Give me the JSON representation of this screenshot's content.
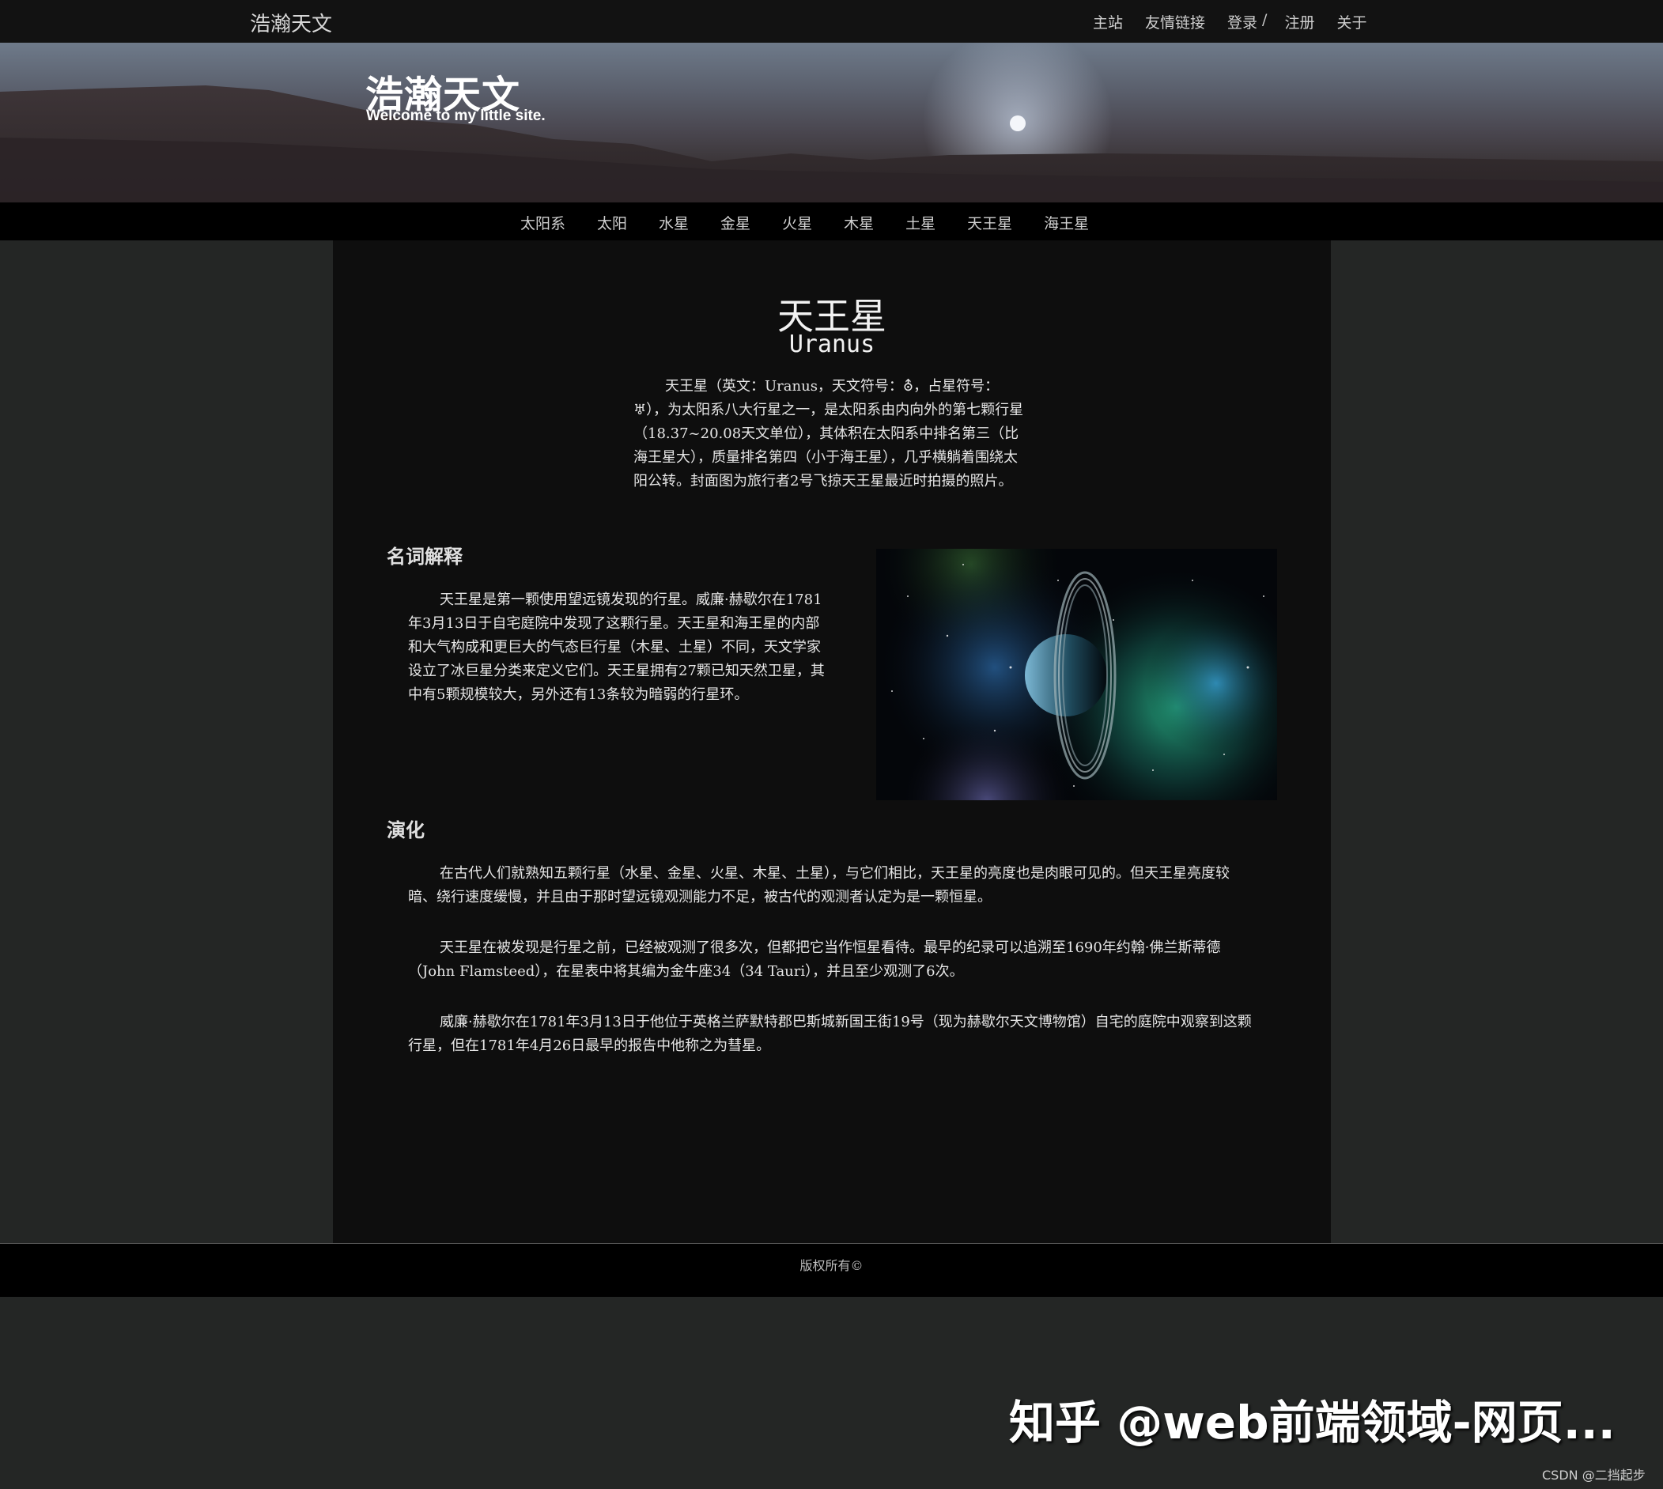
{
  "topbar": {
    "site_name": "浩瀚天文",
    "links": {
      "main": "主站",
      "friends": "友情链接",
      "login": "登录",
      "sep": "/",
      "register": "注册",
      "about": "关于"
    }
  },
  "banner": {
    "title": "浩瀚天文",
    "subtitle": "Welcome to my little site."
  },
  "nav": {
    "items": [
      "太阳系",
      "太阳",
      "水星",
      "金星",
      "火星",
      "木星",
      "土星",
      "天王星",
      "海王星"
    ]
  },
  "article": {
    "title_cn": "天王星",
    "title_en": "Uranus",
    "intro": "天王星（英文：Uranus，天文符号：⛢，占星符号：♅），为太阳系八大行星之一，是太阳系由内向外的第七颗行星（18.37~20.08天文单位），其体积在太阳系中排名第三（比海王星大），质量排名第四（小于海王星），几乎横躺着围绕太阳公转。封面图为旅行者2号飞掠天王星最近时拍摄的照片。",
    "terms_heading": "名词解释",
    "terms_text": "天王星是第一颗使用望远镜发现的行星。威廉·赫歇尔在1781年3月13日于自宅庭院中发现了这颗行星。天王星和海王星的内部和大气构成和更巨大的气态巨行星（木星、土星）不同，天文学家设立了冰巨星分类来定义它们。天王星拥有27颗已知天然卫星，其中有5颗规模较大，另外还有13条较为暗弱的行星环。",
    "evolution_heading": "演化",
    "evolution_paragraphs": [
      "在古代人们就熟知五颗行星（水星、金星、火星、木星、土星），与它们相比，天王星的亮度也是肉眼可见的。但天王星亮度较暗、绕行速度缓慢，并且由于那时望远镜观测能力不足，被古代的观测者认定为是一颗恒星。",
      "天王星在被发现是行星之前，已经被观测了很多次，但都把它当作恒星看待。最早的纪录可以追溯至1690年约翰·佛兰斯蒂德（John Flamsteed），在星表中将其编为金牛座34（34 Tauri），并且至少观测了6次。",
      "威廉·赫歇尔在1781年3月13日于他位于英格兰萨默特郡巴斯城新国王街19号（现为赫歇尔天文博物馆）自宅的庭院中观察到这颗行星，但在1781年4月26日最早的报告中他称之为彗星。"
    ]
  },
  "footer": {
    "copyright": "版权所有©"
  },
  "watermark": {
    "text": "知乎 @web前端领域-网页...",
    "csdn": "CSDN @二挡起步"
  }
}
